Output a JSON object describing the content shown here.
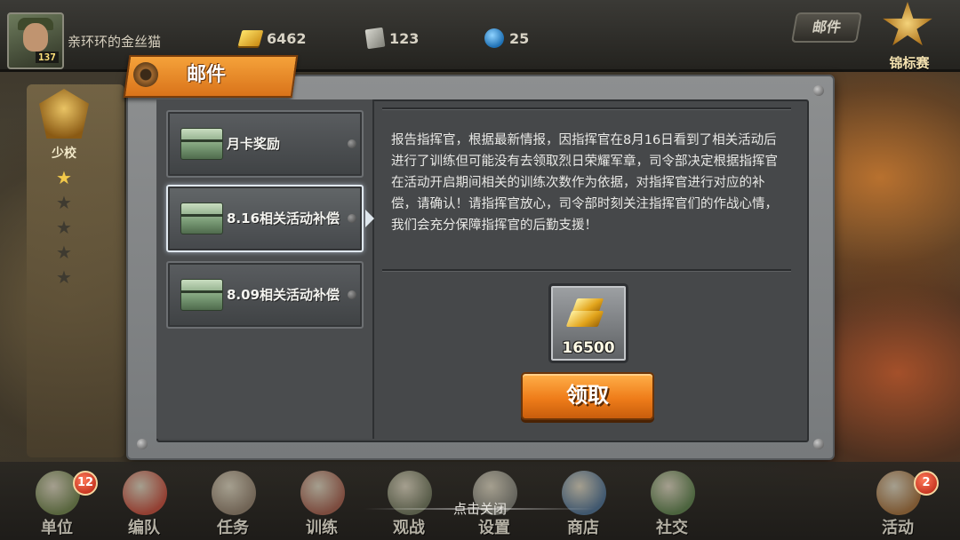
{
  "topbar": {
    "player_name": "亲环环的金丝猫",
    "level": "137",
    "gold": "6462",
    "medals": "123",
    "gems": "25",
    "mail_tab": "邮件",
    "tournament": "锦标赛"
  },
  "rank": {
    "title": "少校",
    "stars": [
      "★",
      "★",
      "★",
      "★",
      "★"
    ],
    "filled_stars": 1
  },
  "dialog": {
    "title": "邮件",
    "mails": [
      {
        "label": "月卡奖励"
      },
      {
        "label": "8.16相关活动补偿"
      },
      {
        "label": "8.09相关活动补偿"
      }
    ],
    "selected_index": 1,
    "message": "报告指挥官，根据最新情报，因指挥官在8月16日看到了相关活动后进行了训练但可能没有去领取烈日荣耀军章，司令部决定根据指挥官在活动开启期间相关的训练次数作为依据，对指挥官进行对应的补偿，请确认！请指挥官放心，司令部时刻关注指挥官们的作战心情，我们会充分保障指挥官的后勤支援！",
    "reward_amount": "16500",
    "reward_icon": "gold-bars-icon",
    "claim_label": "领取"
  },
  "close_hint": "点击关闭",
  "bottom_nav": [
    {
      "label": "单位",
      "badge": "12",
      "color": "#6b7d4a"
    },
    {
      "label": "编队",
      "badge": "",
      "color": "#b84a3a"
    },
    {
      "label": "任务",
      "badge": "",
      "color": "#8a7a68"
    },
    {
      "label": "训练",
      "badge": "",
      "color": "#9a5a4a"
    },
    {
      "label": "观战",
      "badge": "",
      "color": "#6a7058"
    },
    {
      "label": "设置",
      "badge": "",
      "color": "#7a7a72"
    },
    {
      "label": "商店",
      "badge": "",
      "color": "#4a6a8a"
    },
    {
      "label": "社交",
      "badge": "",
      "color": "#5a7a4a"
    },
    {
      "label": "活动",
      "badge": "2",
      "color": "#9a6a3a"
    }
  ],
  "colors": {
    "accent_orange": "#ef7d1a",
    "panel_gray": "#46484a",
    "badge_red": "#b21c0c"
  }
}
